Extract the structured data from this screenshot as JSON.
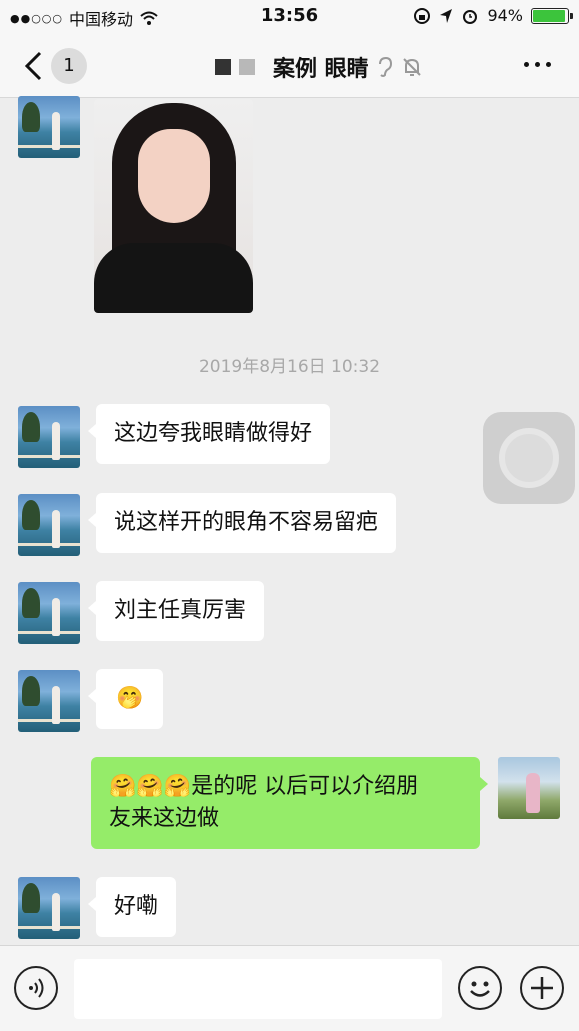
{
  "status_bar": {
    "signal_dots": "●●○○○",
    "carrier": "中国移动",
    "time": "13:56",
    "battery_pct": "94%",
    "battery_level": 0.94,
    "icons": [
      "wifi-icon",
      "rotation-lock-icon",
      "location-icon",
      "alarm-icon"
    ]
  },
  "nav": {
    "back_count": "1",
    "title": "案例 眼睛",
    "icons": [
      "back-arrow-icon",
      "ear-icon",
      "mute-bell-icon",
      "more-icon"
    ]
  },
  "messages": {
    "timestamp": "2019年8月16日 10:32",
    "m1": "这边夸我眼睛做得好",
    "m2": "说这样开的眼角不容易留疤",
    "m3": "刘主任真厉害",
    "m4_emoji": "🤭",
    "m5_emoji": "🤗🤗🤗",
    "m5_line1": "是的呢  以后可以介绍朋",
    "m5_line2": "友来这边做",
    "m6": "好嘞"
  },
  "input_bar": {
    "placeholder": "",
    "icons": [
      "voice-icon",
      "emoji-icon",
      "plus-icon"
    ]
  },
  "colors": {
    "my_bubble": "#95ec69",
    "their_bubble": "#ffffff",
    "background": "#ededed",
    "battery": "#3cc43c"
  }
}
